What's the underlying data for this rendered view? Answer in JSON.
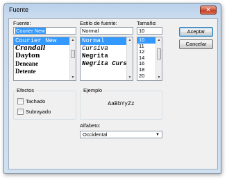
{
  "window": {
    "title": "Fuente",
    "close_glyph": "✕"
  },
  "font": {
    "label": "Fuente:",
    "value": "Courier New",
    "items": [
      "Courier New",
      "Crandall",
      "Dayton",
      "Deneane",
      "Detente"
    ]
  },
  "style": {
    "label": "Estilo de fuente:",
    "value": "Normal",
    "items": [
      "Normal",
      "Cursiva",
      "Negrita",
      "Negrita Cursiva"
    ]
  },
  "size": {
    "label": "Tamaño:",
    "value": "10",
    "items": [
      "10",
      "11",
      "12",
      "14",
      "16",
      "18",
      "20"
    ]
  },
  "buttons": {
    "accept": "Aceptar",
    "cancel": "Cancelar"
  },
  "effects": {
    "label": "Efectos",
    "strikeout": "Tachado",
    "underline": "Subrayado"
  },
  "sample": {
    "label": "Ejemplo",
    "text": "AaBbYyZz"
  },
  "script": {
    "label": "Alfabeto:",
    "value": "Occidental"
  },
  "icons": {
    "scroll_up": "▲",
    "scroll_down": "▼",
    "dropdown": "▼"
  }
}
